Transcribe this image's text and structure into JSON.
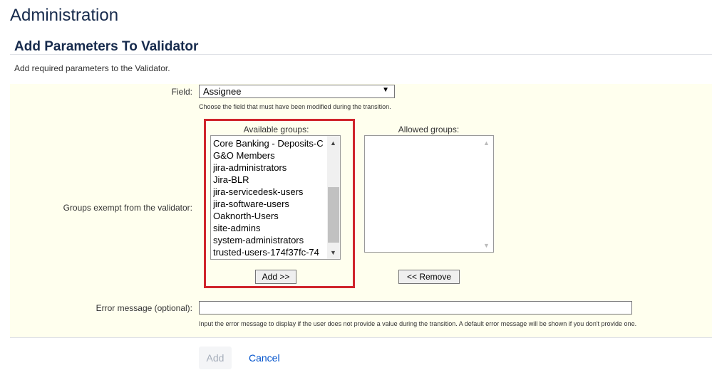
{
  "header": {
    "title": "Administration"
  },
  "section": {
    "title": "Add Parameters To Validator",
    "description": "Add required parameters to the Validator."
  },
  "form": {
    "field": {
      "label": "Field:",
      "selected": "Assignee",
      "hint": "Choose the field that must have been modified during the transition."
    },
    "groups": {
      "label": "Groups exempt from the validator:",
      "available_label": "Available groups:",
      "available_items": [
        "Core Banking - Deposits-C",
        "G&O Members",
        "jira-administrators",
        "Jira-BLR",
        "jira-servicedesk-users",
        "jira-software-users",
        "Oaknorth-Users",
        "site-admins",
        "system-administrators",
        "trusted-users-174f37fc-74"
      ],
      "allowed_label": "Allowed groups:",
      "allowed_items": [],
      "add_label": "Add >>",
      "remove_label": "<< Remove"
    },
    "error_message": {
      "label": "Error message (optional):",
      "value": "",
      "hint": "Input the error message to display if the user does not provide a value during the transition. A default error message will be shown if you don't provide one."
    }
  },
  "actions": {
    "submit_label": "Add",
    "cancel_label": "Cancel"
  },
  "colors": {
    "highlight": "#d0252b",
    "link": "#0052cc",
    "panel_bg": "#ffffee"
  }
}
